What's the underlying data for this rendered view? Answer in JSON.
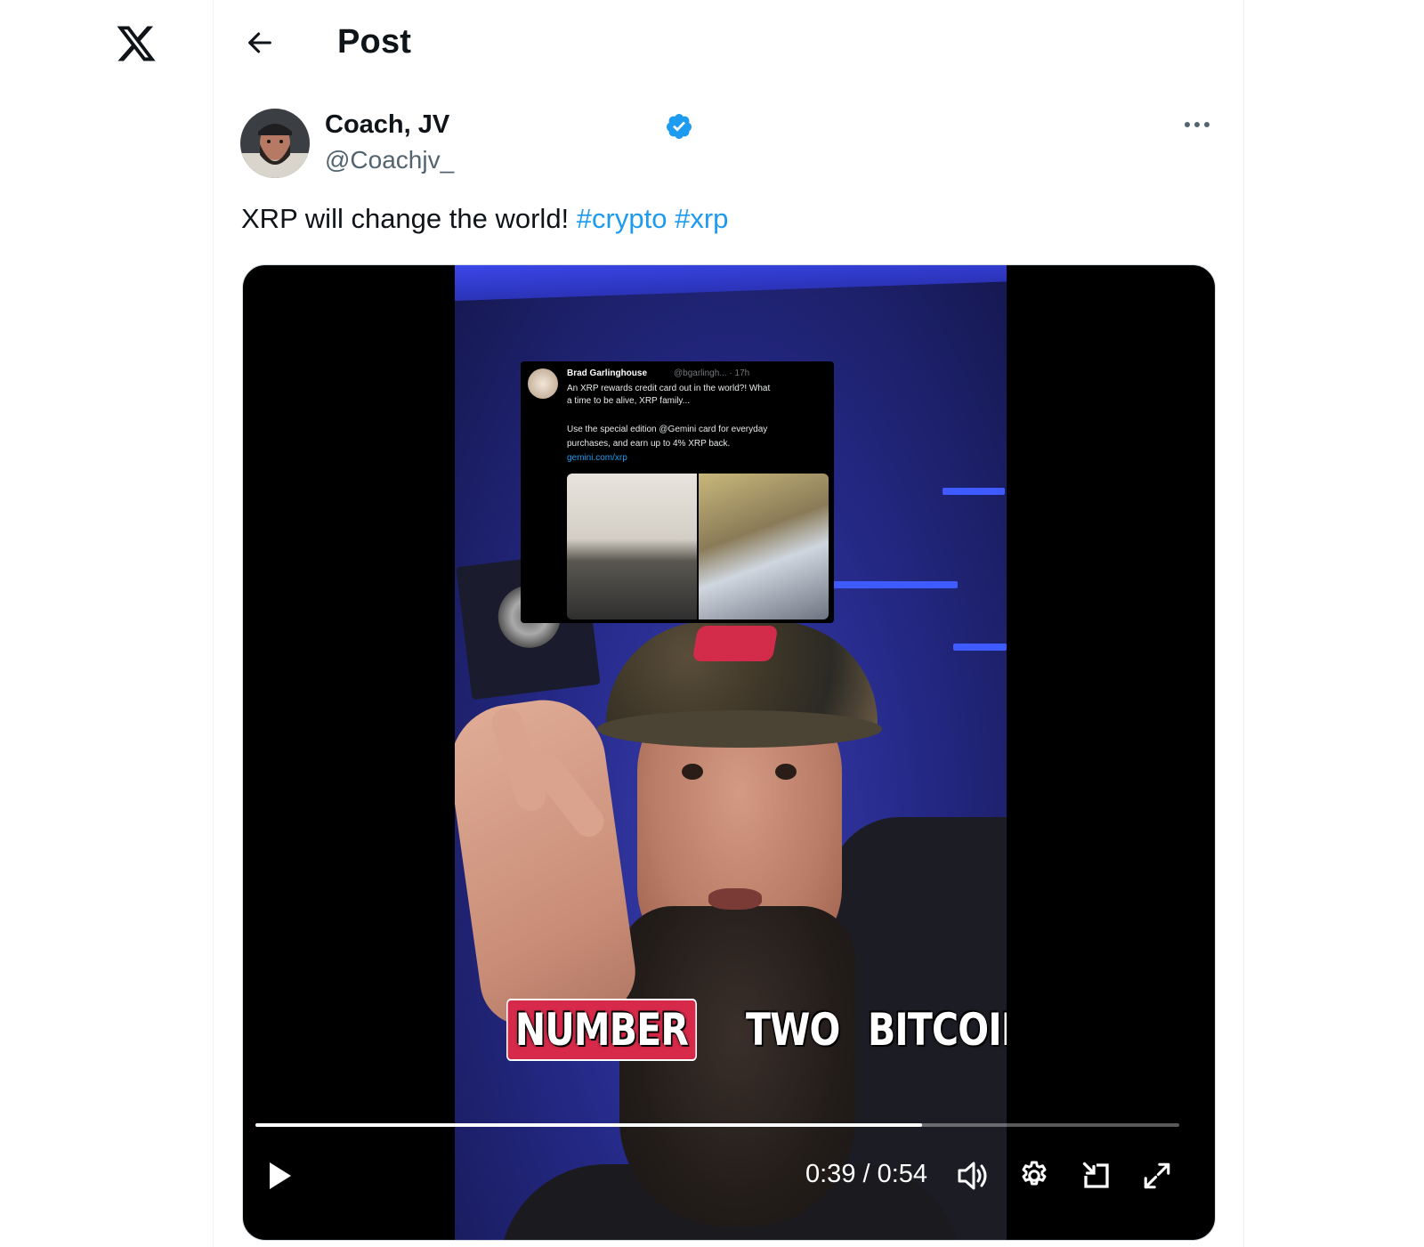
{
  "header": {
    "title": "Post"
  },
  "post": {
    "author_name": "Coach, JV",
    "author_handle": "@Coachjv_",
    "text_prefix": "XRP will change the world!",
    "hashtags": [
      "#crypto",
      "#xrp"
    ]
  },
  "video": {
    "current_time": "0:39",
    "duration": "0:54",
    "time_display": "0:39 / 0:54",
    "progress": 0.722,
    "caption_words": [
      "NUMBER",
      "TWO",
      "BITCOIN"
    ],
    "caption_highlight_color": "#d72949",
    "embedded_tweet": {
      "name": "Brad Garlinghouse",
      "meta": "@bgarlingh... · 17h",
      "line1": "An XRP rewards credit card out in the world?! What",
      "line2": "a time to be alive, XRP family...",
      "line3": "Use the special edition @Gemini card for everyday",
      "line4": "purchases, and earn up to 4% XRP back.",
      "line5": "gemini.com/xrp"
    }
  },
  "colors": {
    "accent": "#1d9bf0",
    "text": "#0f1419",
    "muted": "#536471"
  },
  "icons": [
    "x-logo-icon",
    "back-arrow-icon",
    "verified-badge-icon",
    "more-icon",
    "play-icon",
    "volume-icon",
    "settings-icon",
    "dock-icon",
    "fullscreen-icon"
  ]
}
